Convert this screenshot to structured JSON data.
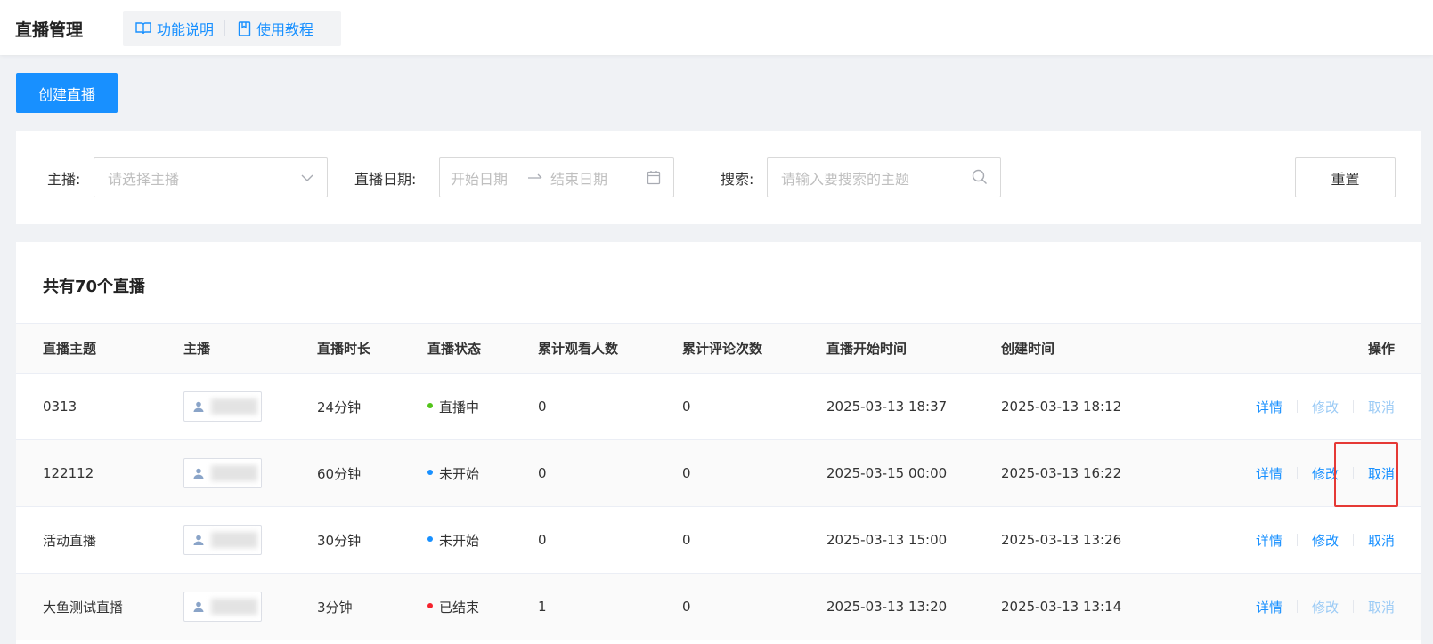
{
  "header": {
    "title": "直播管理",
    "links": [
      {
        "label": "功能说明",
        "icon": "book-icon"
      },
      {
        "label": "使用教程",
        "icon": "document-icon"
      }
    ]
  },
  "toolbar": {
    "create_label": "创建直播"
  },
  "filters": {
    "anchor_label": "主播:",
    "anchor_placeholder": "请选择主播",
    "date_label": "直播日期:",
    "date_start_placeholder": "开始日期",
    "date_end_placeholder": "结束日期",
    "search_label": "搜索:",
    "search_placeholder": "请输入要搜索的主题",
    "reset_label": "重置"
  },
  "list": {
    "count_text": "共有70个直播",
    "columns": [
      "直播主题",
      "主播",
      "直播时长",
      "直播状态",
      "累计观看人数",
      "累计评论次数",
      "直播开始时间",
      "创建时间",
      "操作"
    ],
    "rows": [
      {
        "topic": "0313",
        "duration": "24分钟",
        "status": "直播中",
        "status_color": "#52c41a",
        "viewers": "0",
        "comments": "0",
        "start": "2025-03-13 18:37",
        "created": "2025-03-13 18:12",
        "detail": "详情",
        "edit": "修改",
        "cancel": "取消",
        "edit_enabled": false,
        "cancel_enabled": false
      },
      {
        "topic": "122112",
        "duration": "60分钟",
        "status": "未开始",
        "status_color": "#1890ff",
        "viewers": "0",
        "comments": "0",
        "start": "2025-03-15 00:00",
        "created": "2025-03-13 16:22",
        "detail": "详情",
        "edit": "修改",
        "cancel": "取消",
        "edit_enabled": true,
        "cancel_enabled": true
      },
      {
        "topic": "活动直播",
        "duration": "30分钟",
        "status": "未开始",
        "status_color": "#1890ff",
        "viewers": "0",
        "comments": "0",
        "start": "2025-03-13 15:00",
        "created": "2025-03-13 13:26",
        "detail": "详情",
        "edit": "修改",
        "cancel": "取消",
        "edit_enabled": true,
        "cancel_enabled": true
      },
      {
        "topic": "大鱼测试直播",
        "duration": "3分钟",
        "status": "已结束",
        "status_color": "#f5222d",
        "viewers": "1",
        "comments": "0",
        "start": "2025-03-13 13:20",
        "created": "2025-03-13 13:14",
        "detail": "详情",
        "edit": "修改",
        "cancel": "取消",
        "edit_enabled": false,
        "cancel_enabled": false
      }
    ]
  },
  "colors": {
    "primary": "#1890ff",
    "highlight": "#e53935"
  }
}
